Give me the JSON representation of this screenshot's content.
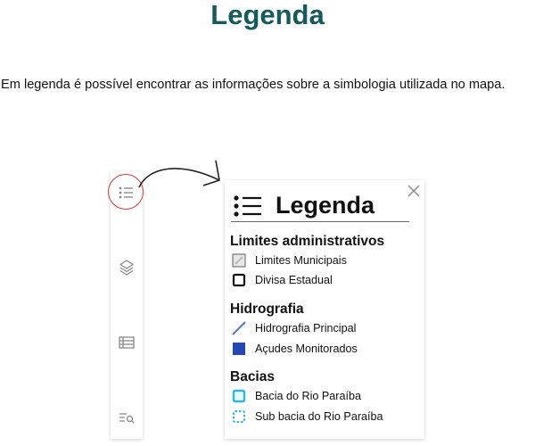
{
  "heading": "Legenda",
  "description": "Em legenda é possível encontrar as informações sobre a simbologia utilizada no mapa.",
  "toolbar": {
    "tools": [
      {
        "icon": "legend-list-icon",
        "active": true
      },
      {
        "icon": "layers-icon"
      },
      {
        "icon": "table-icon"
      },
      {
        "icon": "search-list-icon"
      }
    ],
    "highlight_color": "#d23a3a"
  },
  "panel": {
    "title": "Legenda",
    "close_icon": "close-icon",
    "sections": [
      {
        "title": "Limites administrativos",
        "items": [
          {
            "label": "Limites Municipais",
            "symbol": "municipal-limits-symbol-icon"
          },
          {
            "label": "Divisa Estadual",
            "symbol": "state-border-symbol-icon"
          }
        ]
      },
      {
        "title": "Hidrografia",
        "items": [
          {
            "label": "Hidrografia Principal",
            "symbol": "main-hydrography-line-icon",
            "color": "#5577cc"
          },
          {
            "label": "Açudes Monitorados",
            "symbol": "monitored-reservoir-symbol-icon",
            "color": "#2447b5"
          }
        ]
      },
      {
        "title": "Bacias",
        "items": [
          {
            "label": "Bacia do Rio Paraíba",
            "symbol": "basin-symbol-icon",
            "color": "#2fb8f0"
          },
          {
            "label": "Sub bacia do Rio Paraíba",
            "symbol": "sub-basin-symbol-icon",
            "color": "#2fb8f0"
          }
        ]
      }
    ]
  },
  "colors": {
    "heading": "#155a5f",
    "icon_gray": "#888888"
  }
}
